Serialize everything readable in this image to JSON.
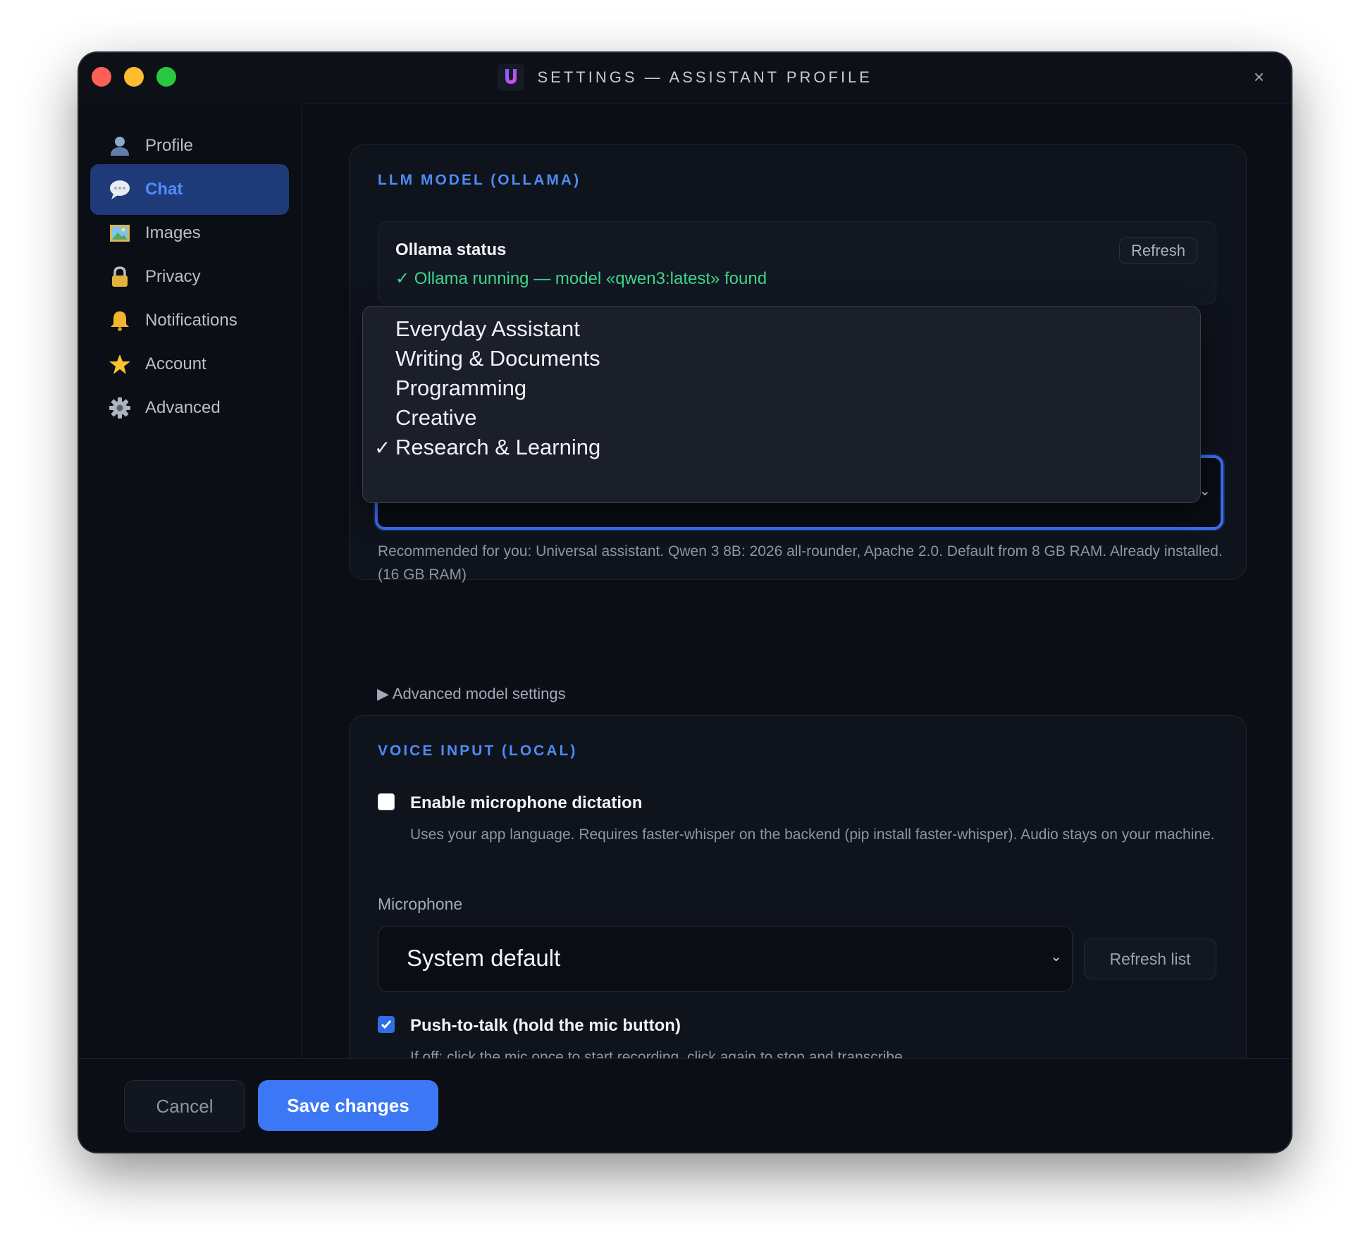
{
  "window": {
    "title": "SETTINGS — ASSISTANT PROFILE",
    "close_glyph": "×"
  },
  "sidebar": {
    "items": [
      {
        "label": "Profile",
        "icon": "user-icon",
        "active": false
      },
      {
        "label": "Chat",
        "icon": "speech-bubble-icon",
        "active": true
      },
      {
        "label": "Images",
        "icon": "picture-icon",
        "active": false
      },
      {
        "label": "Privacy",
        "icon": "lock-icon",
        "active": false
      },
      {
        "label": "Notifications",
        "icon": "bell-icon",
        "active": false
      },
      {
        "label": "Account",
        "icon": "star-icon",
        "active": false
      },
      {
        "label": "Advanced",
        "icon": "gear-icon",
        "active": false
      }
    ]
  },
  "llm": {
    "heading": "LLM MODEL (OLLAMA)",
    "status_title": "Ollama status",
    "status_text": "✓ Ollama running — model «qwen3:latest» found",
    "refresh_label": "Refresh",
    "dropdown_options": [
      "Everyday Assistant",
      "Writing & Documents",
      "Programming",
      "Creative",
      "Research & Learning"
    ],
    "selected_option": "Research & Learning",
    "check_glyph": "✓",
    "hint": "Recommended for you: Universal assistant. Qwen 3 8B: 2026 all-rounder, Apache 2.0. Default from 8 GB RAM. Already installed. (16 GB RAM)",
    "advanced_link": "▶ Advanced model settings"
  },
  "voice": {
    "heading": "VOICE INPUT (LOCAL)",
    "dictation_label": "Enable microphone dictation",
    "dictation_checked": false,
    "dictation_hint": "Uses your app language. Requires faster-whisper on the backend (pip install faster-whisper). Audio stays on your machine.",
    "microphone_label": "Microphone",
    "microphone_value": "System default",
    "refresh_list_label": "Refresh list",
    "ptt_label": "Push-to-talk (hold the mic button)",
    "ptt_checked": true,
    "ptt_hint": "If off: click the mic once to start recording, click again to stop and transcribe."
  },
  "footer": {
    "cancel_label": "Cancel",
    "save_label": "Save changes"
  },
  "colors": {
    "accent": "#3c78f5",
    "heading": "#4d8bf5",
    "status_ok": "#3ed68a",
    "background": "#0b0e15"
  }
}
